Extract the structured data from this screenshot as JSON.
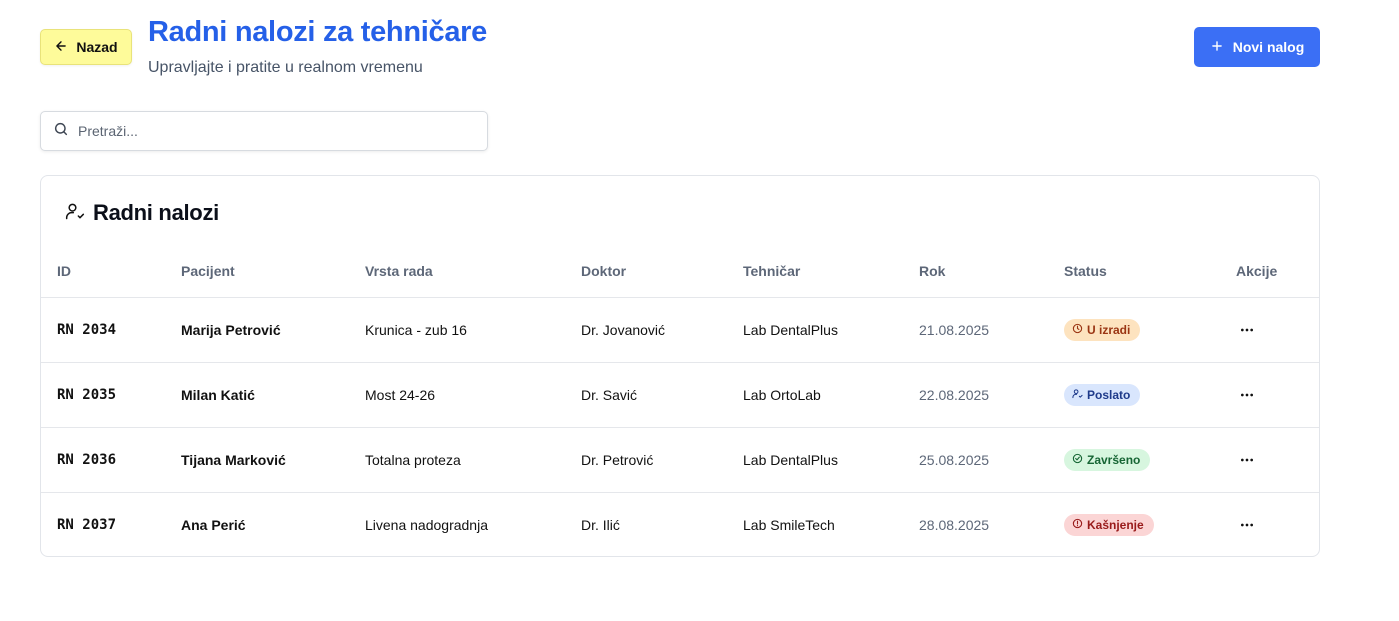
{
  "header": {
    "back_label": "Nazad",
    "title": "Radni nalozi za tehničare",
    "subtitle": "Upravljajte i pratite u realnom vremenu",
    "new_label": "Novi nalog"
  },
  "search": {
    "placeholder": "Pretraži...",
    "value": ""
  },
  "card": {
    "title": "Radni nalozi"
  },
  "table": {
    "columns": [
      "ID",
      "Pacijent",
      "Vrsta rada",
      "Doktor",
      "Tehničar",
      "Rok",
      "Status",
      "Akcije"
    ],
    "rows": [
      {
        "id": "RN 2034",
        "patient": "Marija Petrović",
        "work": "Krunica - zub 16",
        "doctor": "Dr. Jovanović",
        "tech": "Lab DentalPlus",
        "due": "21.08.2025",
        "status": "U izradi",
        "status_icon": "clock-icon"
      },
      {
        "id": "RN 2035",
        "patient": "Milan Katić",
        "work": "Most 24-26",
        "doctor": "Dr. Savić",
        "tech": "Lab OrtoLab",
        "due": "22.08.2025",
        "status": "Poslato",
        "status_icon": "user-check-icon"
      },
      {
        "id": "RN 2036",
        "patient": "Tijana Marković",
        "work": "Totalna proteza",
        "doctor": "Dr. Petrović",
        "tech": "Lab DentalPlus",
        "due": "25.08.2025",
        "status": "Završeno",
        "status_icon": "check-circle-icon"
      },
      {
        "id": "RN 2037",
        "patient": "Ana Perić",
        "work": "Livena nadogradnja",
        "doctor": "Dr. Ilić",
        "tech": "Lab SmileTech",
        "due": "28.08.2025",
        "status": "Kašnjenje",
        "status_icon": "alert-circle-icon"
      }
    ]
  },
  "colors": {
    "title": "#2560e8",
    "primary_button": "#3b6ff5",
    "back_button": "#fefb9a",
    "status_in_progress": "#fde3bf",
    "status_sent": "#d9e6fd",
    "status_done": "#d7f6df",
    "status_late": "#fbd5d5"
  },
  "icons": {
    "back": "arrow-left-icon",
    "new": "plus-icon",
    "search": "search-icon",
    "card": "user-check-icon",
    "row_actions": "more-horizontal-icon"
  }
}
